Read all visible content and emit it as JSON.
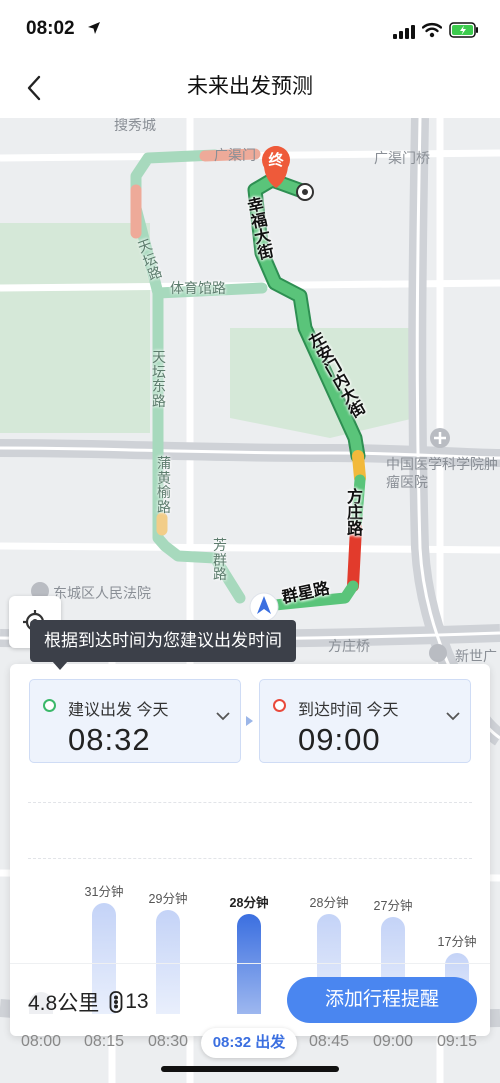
{
  "status_bar": {
    "time": "08:02"
  },
  "nav": {
    "title": "未来出发预测"
  },
  "map": {
    "place_labels": {
      "soxiu": "搜秀城",
      "guangqumen_left": "广渠门",
      "guangqumen_bridge": "广渠门桥",
      "hospital": "中国医学科学院肿瘤医院",
      "court": "东城区人民法院",
      "fangzhuang_bridge": "方庄桥",
      "xinjie": "新世广"
    },
    "streets": {
      "xingfu": "幸福大街",
      "zuoanmennei": "左安门内大街",
      "fangzhuang": "方庄路",
      "qunxing": "群星路",
      "tiyuguan": "体育馆路",
      "tiantan": "天坛路",
      "tiantan_east": "天坛东路",
      "puhuangyu": "蒲黄榆路",
      "fangqun": "芳群路"
    },
    "destination_marker": "终",
    "colors": {
      "smooth": "#5ac47a",
      "slow": "#f2b93b",
      "jam": "#e23b2c",
      "alt_route": "#a7d9bd",
      "alt_jam": "#eeaa99"
    }
  },
  "tooltip": {
    "text": "根据到达时间为您建议出发时间"
  },
  "depart_card": {
    "label": "建议出发 今天",
    "time": "08:32"
  },
  "arrive_card": {
    "label": "到达时间 今天",
    "time": "09:00"
  },
  "chart_data": {
    "type": "bar",
    "categories": [
      "08:00",
      "08:15",
      "08:30",
      "08:32",
      "08:45",
      "09:00",
      "09:15"
    ],
    "tick_labels": [
      "08:00",
      "08:15",
      "08:30",
      "08:32 出发",
      "08:45",
      "09:00",
      "09:15"
    ],
    "values": [
      null,
      31,
      29,
      28,
      28,
      27,
      17
    ],
    "value_labels": [
      "",
      "31分钟",
      "29分钟",
      "28分钟",
      "28分钟",
      "27分钟",
      "17分钟"
    ],
    "selected_index": 3,
    "unit": "分钟",
    "ylim": [
      0,
      33
    ],
    "grid": true
  },
  "summary": {
    "distance": "4.8公里",
    "lights": "13"
  },
  "remind_button": {
    "label": "添加行程提醒"
  }
}
